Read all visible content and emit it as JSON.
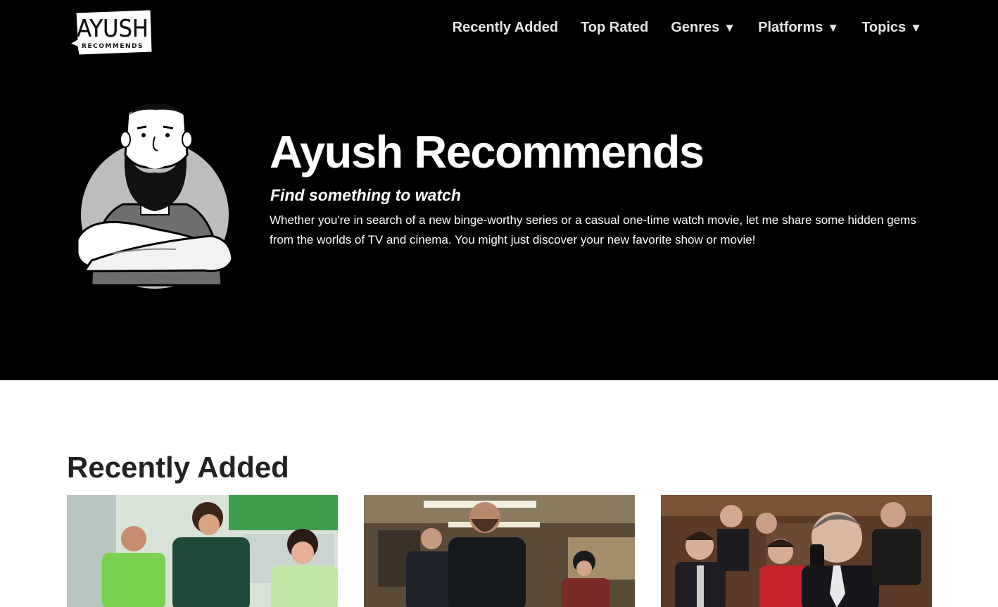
{
  "logo": {
    "wordmark": "AYUSH",
    "tagline": "RECOMMENDS"
  },
  "nav": {
    "items": [
      {
        "label": "Recently Added",
        "has_dropdown": false
      },
      {
        "label": "Top Rated",
        "has_dropdown": false
      },
      {
        "label": "Genres",
        "has_dropdown": true
      },
      {
        "label": "Platforms",
        "has_dropdown": true
      },
      {
        "label": "Topics",
        "has_dropdown": true
      }
    ],
    "caret": "▼"
  },
  "hero": {
    "title": "Ayush Recommends",
    "subtitle": "Find something to watch",
    "description": "Whether you're in search of a new binge-worthy series or a casual one-time watch movie, let me share some hidden gems from the worlds of TV and cinema. You might just discover your new favorite show or movie!"
  },
  "recently_added": {
    "heading": "Recently Added",
    "cards": [
      {
        "image": "supermarket-staff-scene"
      },
      {
        "image": "police-station-scene"
      },
      {
        "image": "office-phone-call-scene"
      }
    ]
  },
  "colors": {
    "hero_bg": "#000000",
    "page_bg": "#ffffff",
    "nav_text": "#e6e6e6",
    "heading_text": "#222222"
  }
}
